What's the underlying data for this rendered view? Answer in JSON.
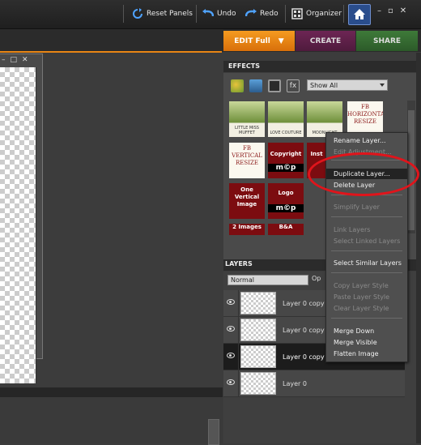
{
  "toolbar": {
    "reset_panels": "Reset Panels",
    "undo": "Undo",
    "redo": "Redo",
    "organizer": "Organizer"
  },
  "modes": {
    "edit_full": "EDIT Full",
    "create": "CREATE",
    "share": "SHARE"
  },
  "effects": {
    "tab": "EFFECTS",
    "filter_value": "Show All",
    "thumbnails": [
      "LITTLE MISS MUFFET",
      "LOVE COUTURE",
      "MOONLIGHT",
      "FB HORIZONTAL RESIZE",
      "FB VERTICAL RESIZE",
      "Copyright",
      "Inst",
      "One Vertical Image",
      "Logo",
      "2 Images",
      "B&A"
    ],
    "mcp_mark": "m©p"
  },
  "layers": {
    "tab": "LAYERS",
    "blend_mode": "Normal",
    "opacity_label": "Op",
    "rows": [
      {
        "name": "Layer 0 copy",
        "selected": false
      },
      {
        "name": "Layer 0 copy",
        "selected": false
      },
      {
        "name": "Layer 0 copy",
        "selected": true
      },
      {
        "name": "Layer 0",
        "selected": false
      }
    ]
  },
  "context_menu": {
    "items": [
      {
        "label": "Rename Layer...",
        "enabled": true
      },
      {
        "label": "Edit Adjustment...",
        "enabled": false
      },
      {
        "label": "Duplicate Layer...",
        "enabled": true,
        "highlighted": true
      },
      {
        "label": "Delete Layer",
        "enabled": true
      },
      {
        "label": "Simplify Layer",
        "enabled": false
      },
      {
        "label": "Link Layers",
        "enabled": false
      },
      {
        "label": "Select Linked Layers",
        "enabled": false
      },
      {
        "label": "Select Similar Layers",
        "enabled": true
      },
      {
        "label": "Copy Layer Style",
        "enabled": false
      },
      {
        "label": "Paste Layer Style",
        "enabled": false
      },
      {
        "label": "Clear Layer Style",
        "enabled": false
      },
      {
        "label": "Merge Down",
        "enabled": true
      },
      {
        "label": "Merge Visible",
        "enabled": true
      },
      {
        "label": "Flatten Image",
        "enabled": true
      }
    ]
  },
  "colors": {
    "accent_orange": "#e88514",
    "annotation_red": "#e0141b"
  }
}
